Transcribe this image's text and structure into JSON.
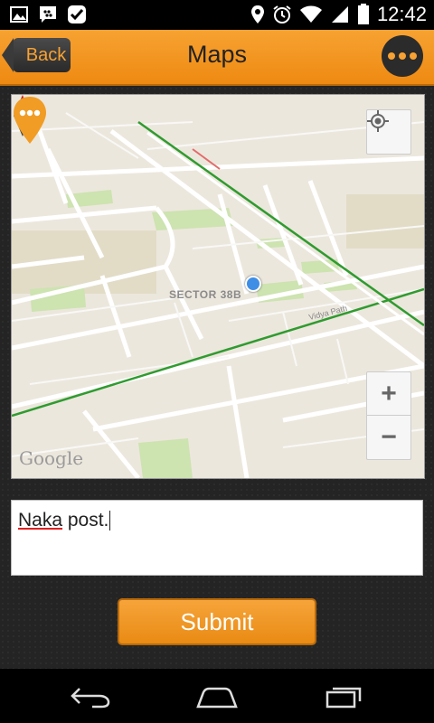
{
  "status_bar": {
    "time": "12:42",
    "left_icons": [
      "gallery-icon",
      "bbm-icon",
      "check-icon"
    ],
    "right_icons": [
      "location-icon",
      "alarm-icon",
      "wifi-icon",
      "signal-icon",
      "battery-icon"
    ]
  },
  "action_bar": {
    "back_label": "Back",
    "title": "Maps",
    "more_icon": "more-dots-icon"
  },
  "map": {
    "location_label": "SECTOR 38B",
    "road_label": "Vidya Path",
    "attribution": "Google",
    "zoom_in_label": "+",
    "zoom_out_label": "−",
    "pin_color": "#f19c24",
    "my_location_color": "#3e8ee6"
  },
  "text_field": {
    "misspelled_word": "Naka",
    "rest": " post."
  },
  "submit_label": "Submit",
  "nav_bar": {
    "icons": [
      "back-nav-icon",
      "home-nav-icon",
      "recents-nav-icon"
    ]
  },
  "colors": {
    "accent": "#f7a232",
    "dark": "#2b2b2b"
  }
}
